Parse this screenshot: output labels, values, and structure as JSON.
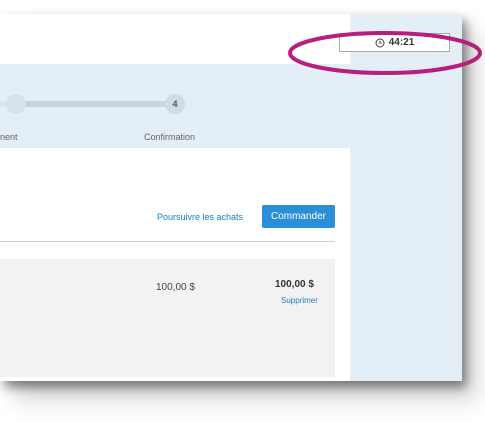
{
  "timer": {
    "icon": "clock-icon",
    "value": "44:21"
  },
  "progress": {
    "step_number": "4",
    "step_left_label": "nent",
    "step_right_label": "Confirmation"
  },
  "cart": {
    "continue_label": "Poursuivre les achats",
    "order_label": "Commander",
    "unit_price": "100,00 $",
    "total_price": "100,00 $",
    "remove_label": "Supprimer"
  },
  "colors": {
    "accent": "#2b8ed8",
    "link": "#1a7cc7",
    "band": "#e4eef7",
    "highlight": "#b5207f"
  }
}
